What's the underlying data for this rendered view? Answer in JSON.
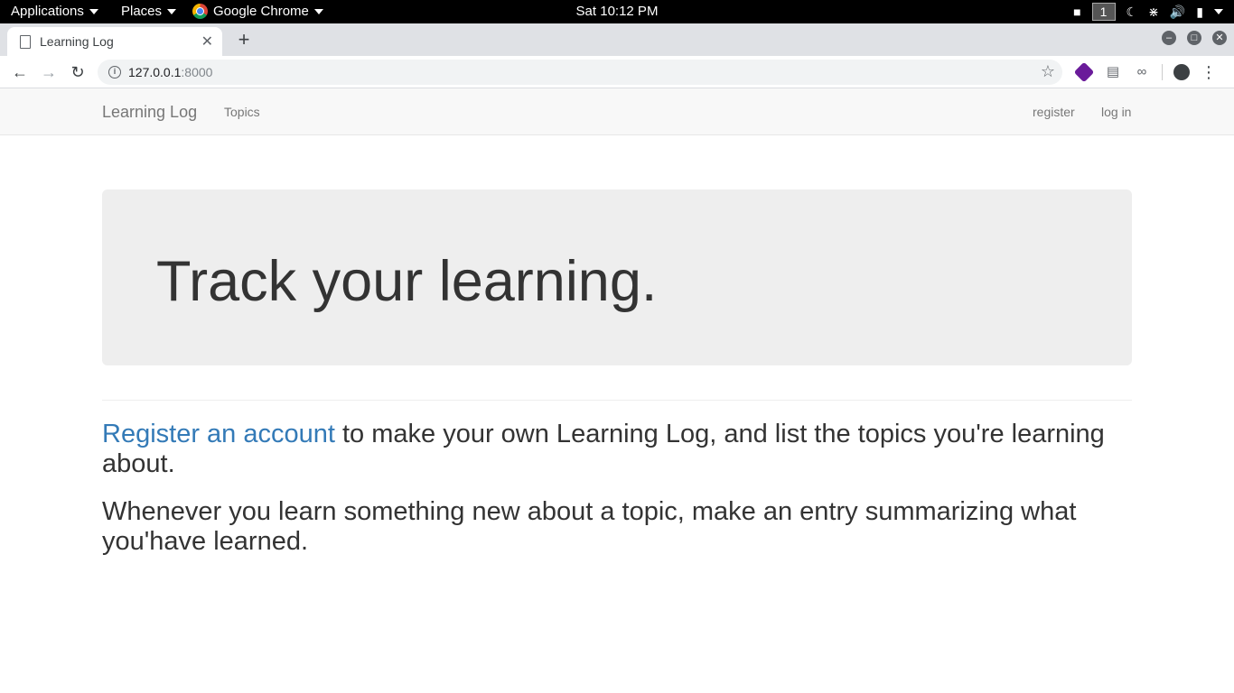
{
  "system_bar": {
    "applications": "Applications",
    "places": "Places",
    "app_name": "Google Chrome",
    "clock": "Sat 10:12 PM",
    "workspace": "1"
  },
  "browser": {
    "tab_title": "Learning Log",
    "url_host": "127.0.0.1",
    "url_port": ":8000"
  },
  "navbar": {
    "brand": "Learning Log",
    "topics": "Topics",
    "register": "register",
    "login": "log in"
  },
  "jumbotron": {
    "heading": "Track your learning."
  },
  "content": {
    "register_link": "Register an account",
    "paragraph1_rest": " to make your own Learning Log, and list the topics you're learning about.",
    "paragraph2": "Whenever you learn something new about a topic, make an entry summarizing what you'have learned."
  },
  "colors": {
    "link": "#337ab7",
    "jumbotron_bg": "#eeeeee",
    "navbar_bg": "#f8f8f8"
  }
}
